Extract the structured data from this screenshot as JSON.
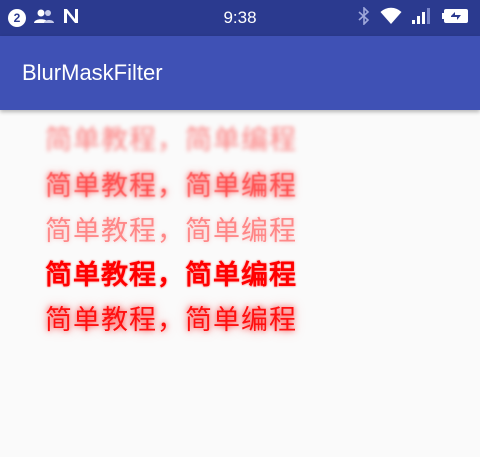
{
  "status_bar": {
    "notification_count": "2",
    "time": "9:38",
    "icons": [
      "notification-badge",
      "contacts-icon",
      "n-logo-icon",
      "bluetooth-icon",
      "wifi-icon",
      "signal-icon",
      "battery-icon"
    ],
    "background": "#2b3a8f"
  },
  "app_bar": {
    "title": "BlurMaskFilter",
    "background": "#3f51b5"
  },
  "content": {
    "lines": [
      {
        "text": "简单教程，简单编程",
        "style": "normal-blur"
      },
      {
        "text": "简单教程，简单编程",
        "style": "solid-blur"
      },
      {
        "text": "简单教程，简单编程",
        "style": "outer-blur"
      },
      {
        "text": "简单教程，简单编程",
        "style": "inner-blur"
      },
      {
        "text": "简单教程，简单编程",
        "style": "glow"
      }
    ],
    "text_color": "#ff0000"
  }
}
